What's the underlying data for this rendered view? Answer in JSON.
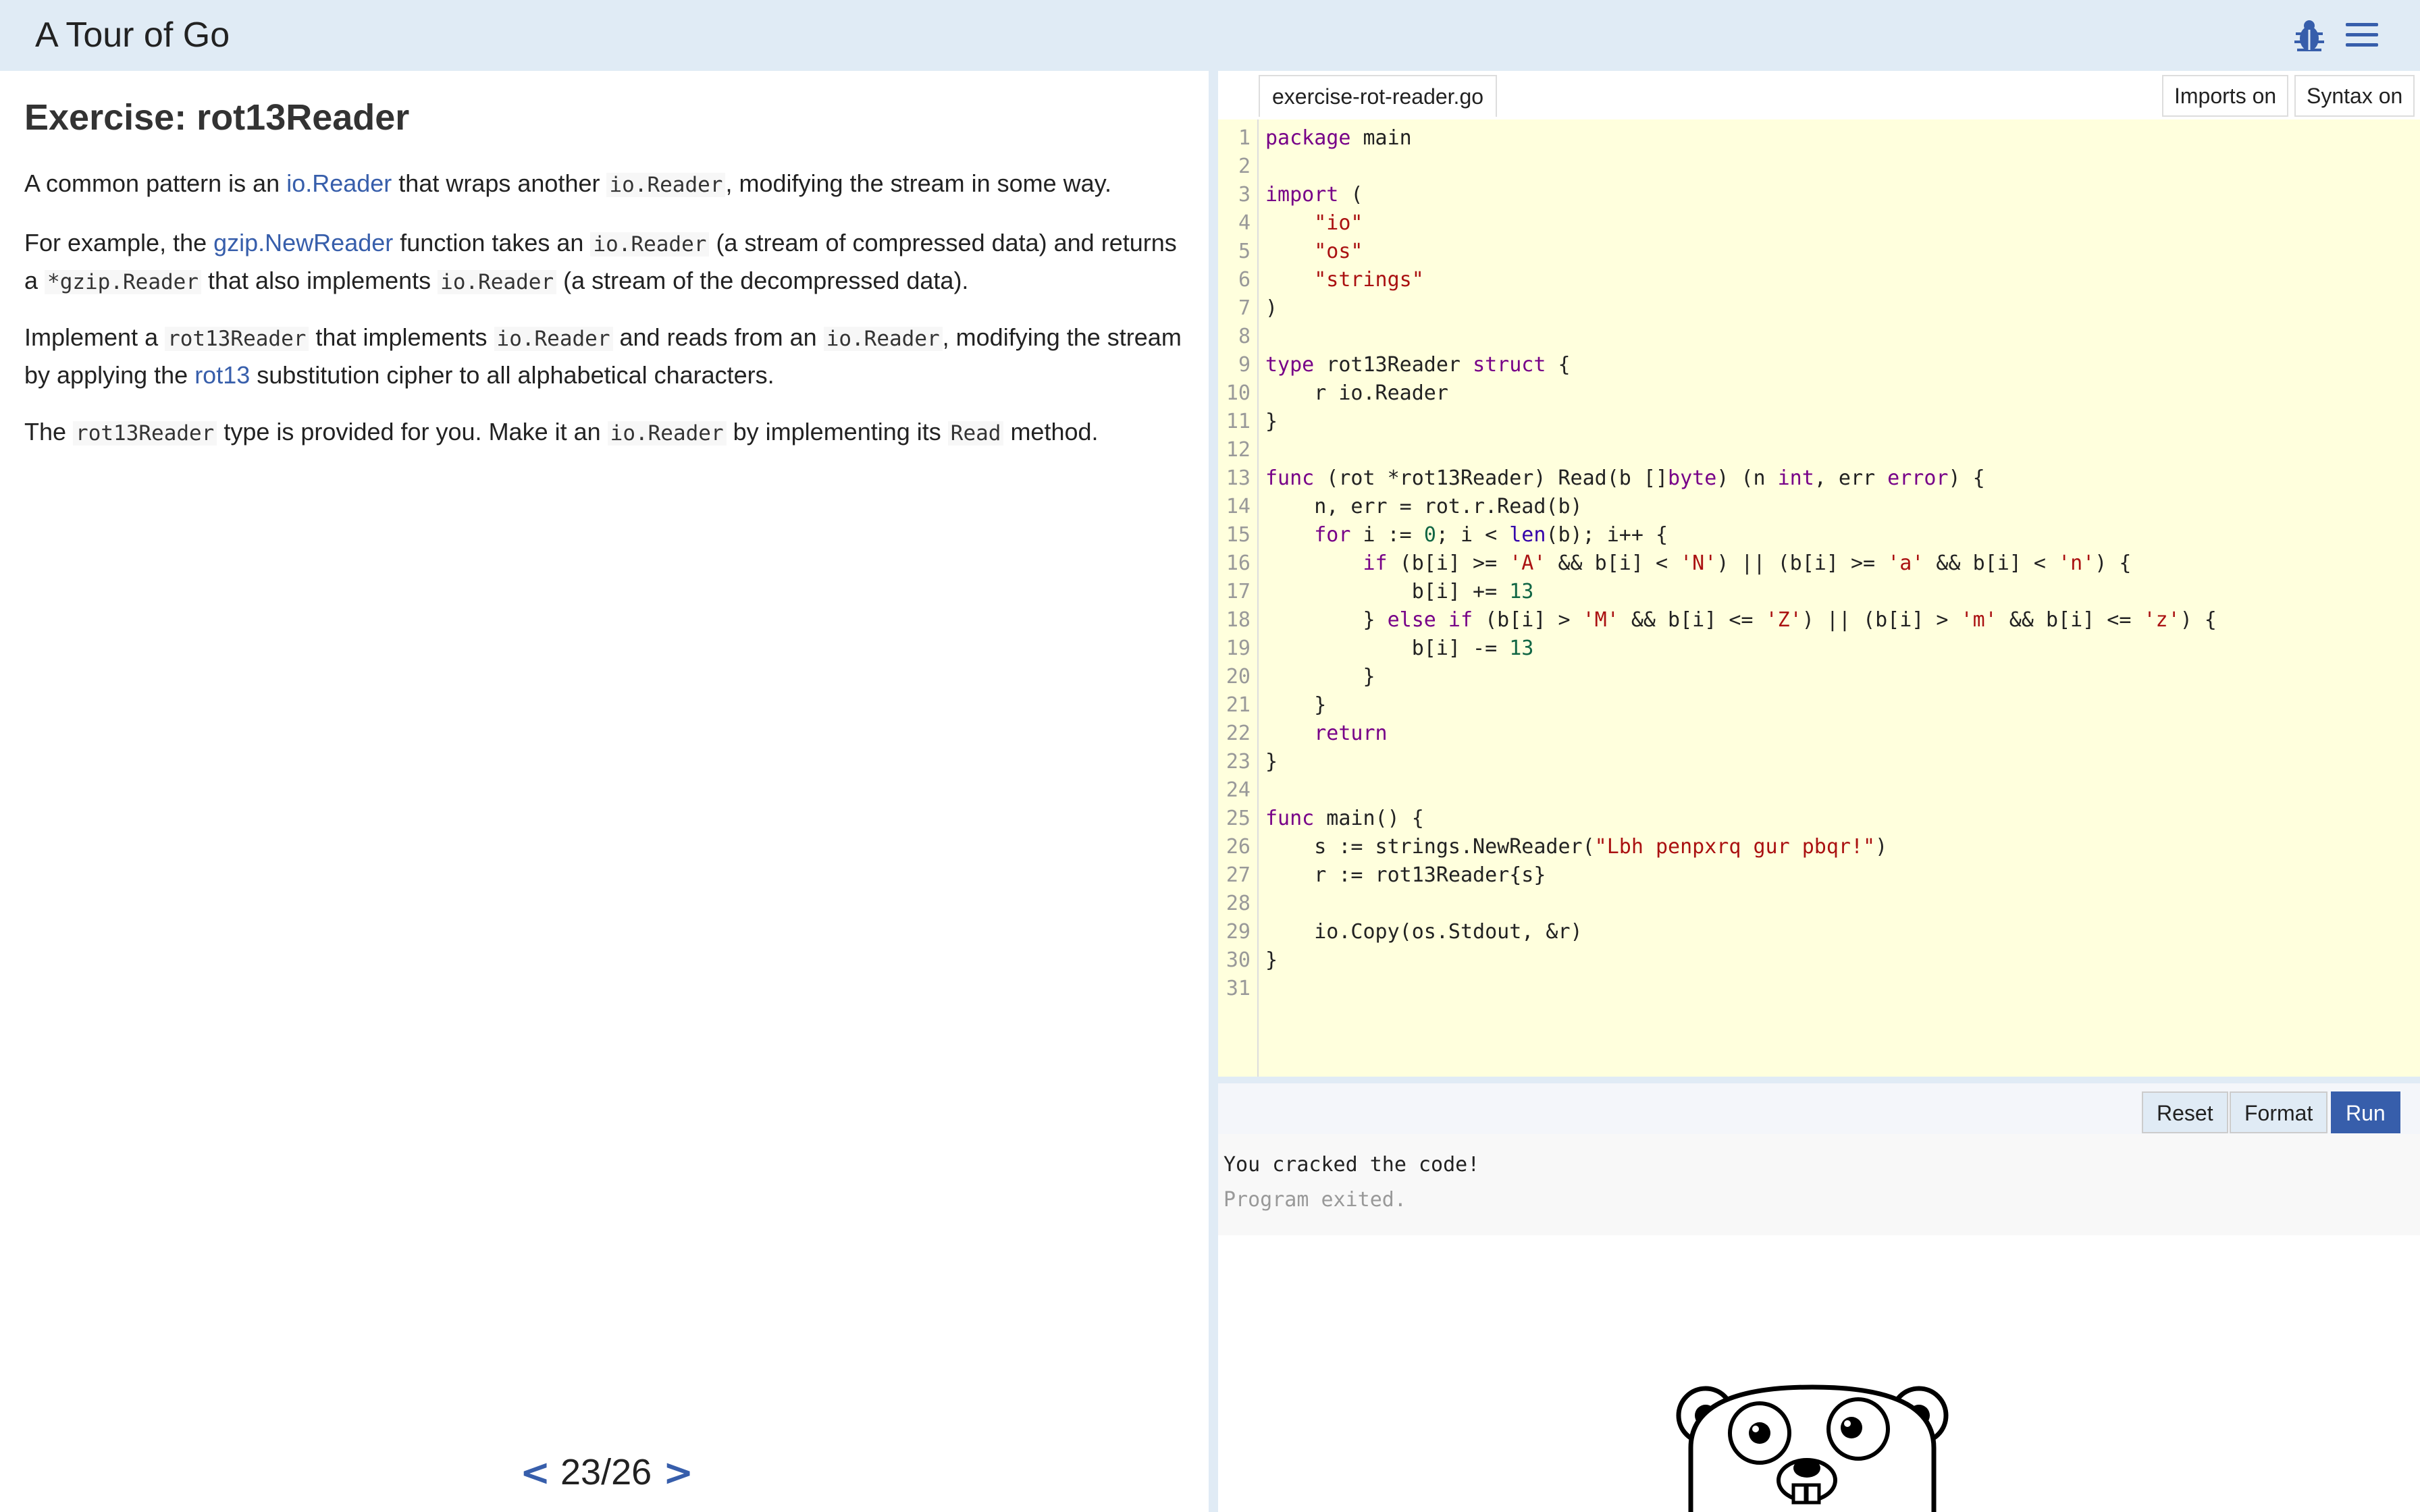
{
  "header": {
    "title": "A Tour of Go",
    "bug_icon": "bug-icon",
    "menu_icon": "hamburger-menu-icon"
  },
  "lesson": {
    "title": "Exercise: rot13Reader",
    "p1": {
      "t1": "A common pattern is an ",
      "link1": "io.Reader",
      "t2": " that wraps another ",
      "code1": "io.Reader",
      "t3": ", modifying the stream in some way."
    },
    "p2": {
      "t1": "For example, the ",
      "link1": "gzip.NewReader",
      "t2": " function takes an ",
      "code1": "io.Reader",
      "t3": " (a stream of compressed data) and returns a ",
      "code2": "*gzip.Reader",
      "t4": " that also implements ",
      "code3": "io.Reader",
      "t5": " (a stream of the decompressed data)."
    },
    "p3": {
      "t1": "Implement a ",
      "code1": "rot13Reader",
      "t2": " that implements ",
      "code2": "io.Reader",
      "t3": " and reads from an ",
      "code3": "io.Reader",
      "t4": ", modifying the stream by applying the ",
      "link1": "rot13",
      "t5": " substitution cipher to all alphabetical characters."
    },
    "p4": {
      "t1": "The ",
      "code1": "rot13Reader",
      "t2": " type is provided for you. Make it an ",
      "code2": "io.Reader",
      "t3": " by implementing its ",
      "code3": "Read",
      "t4": " method."
    }
  },
  "pager": {
    "prev": "<",
    "current": "23/26",
    "next": ">"
  },
  "editor": {
    "filename": "exercise-rot-reader.go",
    "imports_toggle": "Imports on",
    "syntax_toggle": "Syntax on",
    "line_numbers": [
      "1",
      "2",
      "3",
      "4",
      "5",
      "6",
      "7",
      "8",
      "9",
      "10",
      "11",
      "12",
      "13",
      "14",
      "15",
      "16",
      "17",
      "18",
      "19",
      "20",
      "21",
      "22",
      "23",
      "24",
      "25",
      "26",
      "27",
      "28",
      "29",
      "30",
      "31"
    ]
  },
  "code": {
    "l1": {
      "kw": "package",
      "rest": " main"
    },
    "l3": {
      "kw": "import",
      "rest": " ("
    },
    "l4": {
      "ind": "    ",
      "str": "\"io\""
    },
    "l5": {
      "ind": "    ",
      "str": "\"os\""
    },
    "l6": {
      "ind": "    ",
      "str": "\"strings\""
    },
    "l7": {
      "rest": ")"
    },
    "l9": {
      "kw": "type",
      "mid": " rot13Reader ",
      "kw2": "struct",
      "rest": " {"
    },
    "l10": {
      "rest": "    r io.Reader"
    },
    "l11": {
      "rest": "}"
    },
    "l13": {
      "kw": "func",
      "a": " (rot *rot13Reader) Read(b []",
      "bi1": "byte",
      "b": ") (n ",
      "bi2": "int",
      "c": ", err ",
      "bi3": "error",
      "d": ") {"
    },
    "l14": {
      "rest": "    n, err = rot.r.Read(b)"
    },
    "l15": {
      "ind": "    ",
      "kw": "for",
      "a": " i := ",
      "num": "0",
      "b": "; i < ",
      "bi": "len",
      "c": "(b); i++ {"
    },
    "l16": {
      "ind": "        ",
      "kw": "if",
      "a": " (b[i] >= ",
      "s1": "'A'",
      "b": " && b[i] < ",
      "s2": "'N'",
      "c": ") || (b[i] >= ",
      "s3": "'a'",
      "d": " && b[i] < ",
      "s4": "'n'",
      "e": ") {"
    },
    "l17": {
      "ind": "            b[i] += ",
      "num": "13"
    },
    "l18": {
      "ind": "        } ",
      "kw": "else if",
      "a": " (b[i] > ",
      "s1": "'M'",
      "b": " && b[i] <= ",
      "s2": "'Z'",
      "c": ") || (b[i] > ",
      "s3": "'m'",
      "d": " && b[i] <= ",
      "s4": "'z'",
      "e": ") {"
    },
    "l19": {
      "ind": "            b[i] -= ",
      "num": "13"
    },
    "l20": {
      "rest": "        }"
    },
    "l21": {
      "rest": "    }"
    },
    "l22": {
      "ind": "    ",
      "kw": "return"
    },
    "l23": {
      "rest": "}"
    },
    "l25": {
      "kw": "func",
      "rest": " main() {"
    },
    "l26": {
      "a": "    s := strings.NewReader(",
      "str": "\"Lbh penpxrq gur pbqr!\"",
      "b": ")"
    },
    "l27": {
      "rest": "    r := rot13Reader{s}"
    },
    "l29": {
      "rest": "    io.Copy(os.Stdout, &r)"
    },
    "l30": {
      "rest": "}"
    }
  },
  "controls": {
    "reset": "Reset",
    "format": "Format",
    "run": "Run"
  },
  "output": {
    "line1": "You cracked the code!",
    "line2": "Program exited."
  },
  "decor": {
    "gopher": "gopher-mascot-image"
  },
  "colors": {
    "accent": "#375eab",
    "header_bg": "#e0ebf5",
    "editor_bg": "#ffffdd",
    "keyword": "#770088",
    "string": "#aa1111",
    "number": "#116644"
  }
}
